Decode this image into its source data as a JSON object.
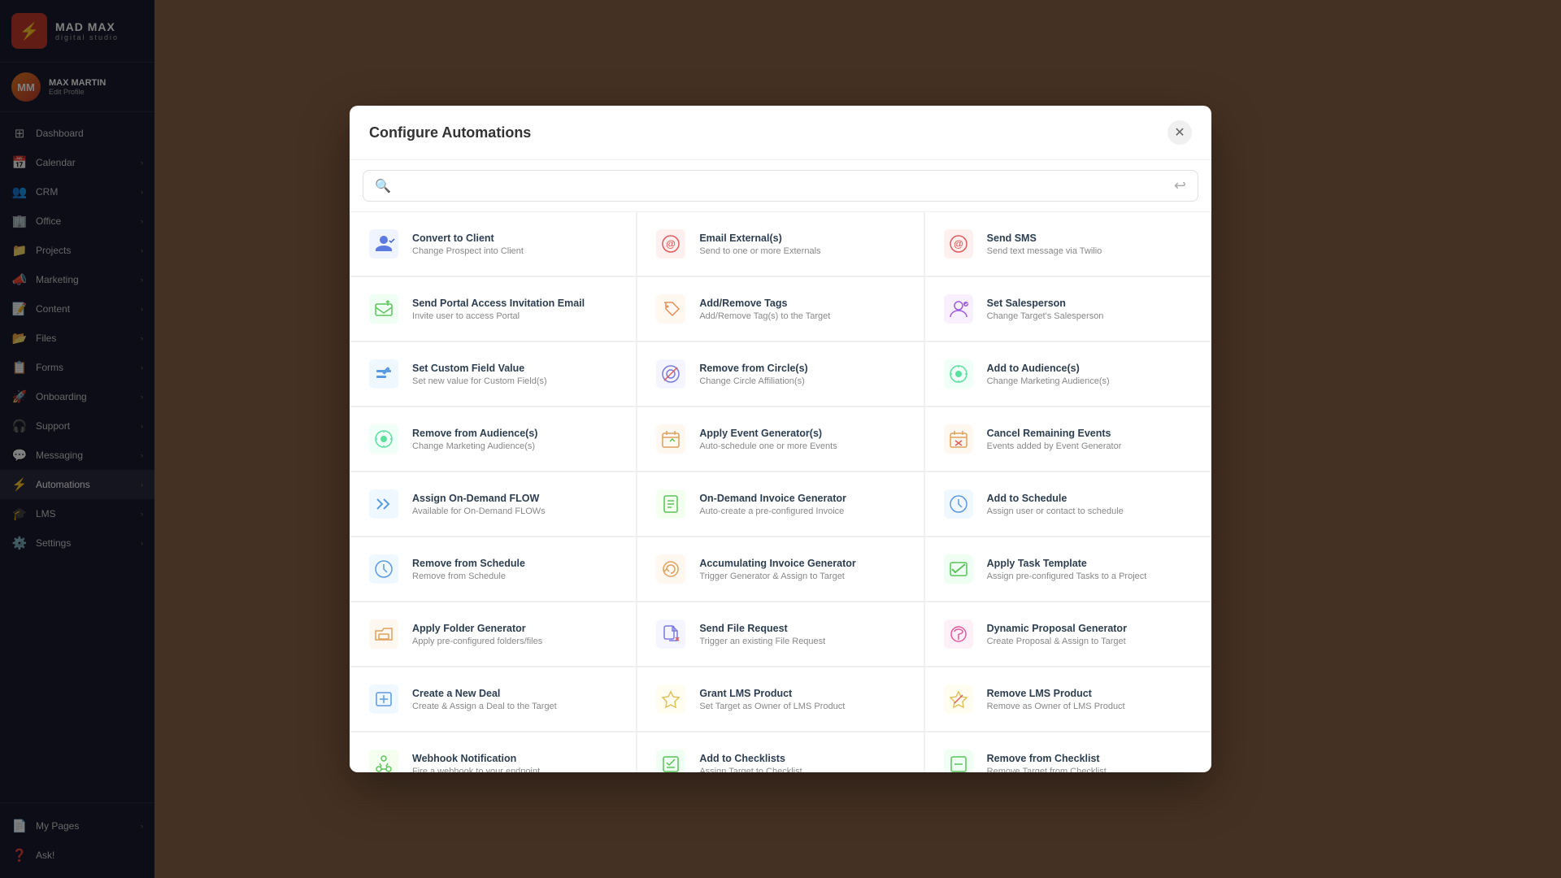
{
  "app": {
    "brand": "MAD MAX",
    "sub": "digital studio",
    "logo_char": "⚡"
  },
  "profile": {
    "name": "MAX MARTIN",
    "edit": "Edit Profile",
    "initials": "MM"
  },
  "nav": {
    "items": [
      {
        "id": "dashboard",
        "label": "Dashboard",
        "icon": "⊞",
        "active": false
      },
      {
        "id": "calendar",
        "label": "Calendar",
        "icon": "📅",
        "active": false,
        "arrow": true
      },
      {
        "id": "crm",
        "label": "CRM",
        "icon": "👥",
        "active": false,
        "arrow": true
      },
      {
        "id": "office",
        "label": "Office",
        "icon": "🏢",
        "active": false,
        "arrow": true
      },
      {
        "id": "projects",
        "label": "Projects",
        "icon": "📁",
        "active": false,
        "arrow": true
      },
      {
        "id": "marketing",
        "label": "Marketing",
        "icon": "📣",
        "active": false,
        "arrow": true
      },
      {
        "id": "content",
        "label": "Content",
        "icon": "📝",
        "active": false,
        "arrow": true
      },
      {
        "id": "files",
        "label": "Files",
        "icon": "📂",
        "active": false,
        "arrow": true
      },
      {
        "id": "forms",
        "label": "Forms",
        "icon": "📋",
        "active": false,
        "arrow": true
      },
      {
        "id": "onboarding",
        "label": "Onboarding",
        "icon": "🚀",
        "active": false,
        "arrow": true
      },
      {
        "id": "support",
        "label": "Support",
        "icon": "🎧",
        "active": false,
        "arrow": true
      },
      {
        "id": "messaging",
        "label": "Messaging",
        "icon": "💬",
        "active": false,
        "arrow": true
      },
      {
        "id": "automations",
        "label": "Automations",
        "icon": "⚡",
        "active": true,
        "arrow": true
      },
      {
        "id": "lms",
        "label": "LMS",
        "icon": "🎓",
        "active": false,
        "arrow": true
      },
      {
        "id": "settings",
        "label": "Settings",
        "icon": "⚙️",
        "active": false,
        "arrow": true
      }
    ],
    "bottom_items": [
      {
        "id": "my-pages",
        "label": "My Pages",
        "icon": "📄",
        "arrow": true
      },
      {
        "id": "ask",
        "label": "Ask!",
        "icon": "❓"
      }
    ]
  },
  "modal": {
    "title": "Configure Automations",
    "search_placeholder": "",
    "automations": [
      {
        "id": "convert-to-client",
        "title": "Convert to Client",
        "desc": "Change Prospect into Client",
        "icon": "👤"
      },
      {
        "id": "email-externals",
        "title": "Email External(s)",
        "desc": "Send to one or more Externals",
        "icon": "@"
      },
      {
        "id": "send-sms",
        "title": "Send SMS",
        "desc": "Send text message via Twilio",
        "icon": "@"
      },
      {
        "id": "send-portal-access",
        "title": "Send Portal Access Invitation Email",
        "desc": "Invite user to access Portal",
        "icon": "✉"
      },
      {
        "id": "add-remove-tags",
        "title": "Add/Remove Tags",
        "desc": "Add/Remove Tag(s) to the Target",
        "icon": "🏷"
      },
      {
        "id": "set-salesperson",
        "title": "Set Salesperson",
        "desc": "Change Target's Salesperson",
        "icon": "⚙"
      },
      {
        "id": "set-custom-field",
        "title": "Set Custom Field Value",
        "desc": "Set new value for Custom Field(s)",
        "icon": "✏"
      },
      {
        "id": "remove-from-circles",
        "title": "Remove from Circle(s)",
        "desc": "Change Circle Affiliation(s)",
        "icon": "⊙"
      },
      {
        "id": "add-to-audiences",
        "title": "Add to Audience(s)",
        "desc": "Change Marketing Audience(s)",
        "icon": "🎯"
      },
      {
        "id": "remove-from-audiences",
        "title": "Remove from Audience(s)",
        "desc": "Change Marketing Audience(s)",
        "icon": "🎯"
      },
      {
        "id": "apply-event-generator",
        "title": "Apply Event Generator(s)",
        "desc": "Auto-schedule one or more Events",
        "icon": "📅"
      },
      {
        "id": "cancel-remaining-events",
        "title": "Cancel Remaining Events",
        "desc": "Events added by Event Generator",
        "icon": "📅"
      },
      {
        "id": "assign-on-demand-flow",
        "title": "Assign On-Demand FLOW",
        "desc": "Available for On-Demand FLOWs",
        "icon": "▶▶"
      },
      {
        "id": "on-demand-invoice-generator",
        "title": "On-Demand Invoice Generator",
        "desc": "Auto-create a pre-configured Invoice",
        "icon": "📄"
      },
      {
        "id": "add-to-schedule",
        "title": "Add to Schedule",
        "desc": "Assign user or contact to schedule",
        "icon": "🕐"
      },
      {
        "id": "remove-from-schedule",
        "title": "Remove from Schedule",
        "desc": "Remove from Schedule",
        "icon": "🕐"
      },
      {
        "id": "accumulating-invoice-generator",
        "title": "Accumulating Invoice Generator",
        "desc": "Trigger Generator & Assign to Target",
        "icon": "⚙"
      },
      {
        "id": "apply-task-template",
        "title": "Apply Task Template",
        "desc": "Assign pre-configured Tasks to a Project",
        "icon": "✔"
      },
      {
        "id": "apply-folder-generator",
        "title": "Apply Folder Generator",
        "desc": "Apply pre-configured folders/files",
        "icon": "📁"
      },
      {
        "id": "send-file-request",
        "title": "Send File Request",
        "desc": "Trigger an existing File Request",
        "icon": "📎"
      },
      {
        "id": "dynamic-proposal-generator",
        "title": "Dynamic Proposal Generator",
        "desc": "Create Proposal & Assign to Target",
        "icon": "⚙"
      },
      {
        "id": "create-new-deal",
        "title": "Create a New Deal",
        "desc": "Create & Assign a Deal to the Target",
        "icon": "📝"
      },
      {
        "id": "grant-lms-product",
        "title": "Grant LMS Product",
        "desc": "Set Target as Owner of LMS Product",
        "icon": "🎓"
      },
      {
        "id": "remove-lms-product",
        "title": "Remove LMS Product",
        "desc": "Remove as Owner of LMS Product",
        "icon": "🎓"
      },
      {
        "id": "webhook-notification",
        "title": "Webhook Notification",
        "desc": "Fire a webhook to your endpoint",
        "icon": "🔗"
      },
      {
        "id": "add-to-checklists",
        "title": "Add to Checklists",
        "desc": "Assign Target to Checklist",
        "icon": "✔"
      },
      {
        "id": "remove-from-checklist",
        "title": "Remove from Checklist",
        "desc": "Remove Target from Checklist",
        "icon": "✔"
      }
    ]
  },
  "icons": {
    "convert_to_client": "👤",
    "email": "@",
    "sms": "💬",
    "portal": "✉",
    "tags": "🏷",
    "salesperson": "👔",
    "custom_field": "✏",
    "circle": "◎",
    "audience": "🎯",
    "event": "📅",
    "flow": "⏩",
    "invoice": "🧾",
    "schedule": "📆",
    "task": "✅",
    "folder": "📁",
    "file": "📎",
    "proposal": "📑",
    "deal": "🤝",
    "lms": "🎓",
    "webhook": "🔗",
    "checklist": "☑"
  }
}
